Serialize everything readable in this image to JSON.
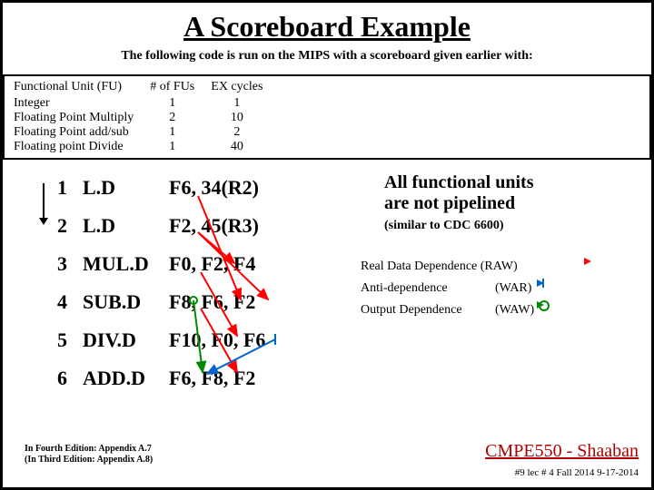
{
  "title": "A Scoreboard Example",
  "subtitle": "The following code is run on the MIPS with a scoreboard given earlier with:",
  "fu_table": {
    "headers": [
      "Functional Unit (FU)",
      "# of FUs",
      "EX cycles"
    ],
    "rows": [
      {
        "name": "Integer",
        "count": "1",
        "cycles": "1"
      },
      {
        "name": "Floating Point Multiply",
        "count": "2",
        "cycles": "10"
      },
      {
        "name": "Floating Point add/sub",
        "count": "1",
        "cycles": "2"
      },
      {
        "name": "Floating point Divide",
        "count": "1",
        "cycles": "40"
      }
    ]
  },
  "code": [
    {
      "n": "1",
      "op": "L.D",
      "args": "F6, 34(R2)"
    },
    {
      "n": "2",
      "op": "L.D",
      "args": "F2, 45(R3)"
    },
    {
      "n": "3",
      "op": "MUL.D",
      "args": "F0, F2, F4"
    },
    {
      "n": "4",
      "op": "SUB.D",
      "args": "F8, F6, F2"
    },
    {
      "n": "5",
      "op": "DIV.D",
      "args": "F10, F0, F6"
    },
    {
      "n": "6",
      "op": "ADD.D",
      "args": "F6, F8, F2"
    }
  ],
  "note_line1": "All functional units",
  "note_line2": "are not pipelined",
  "note2": "(similar to CDC 6600)",
  "legend": {
    "raw": {
      "label": "Real Data Dependence (RAW)"
    },
    "war": {
      "label": "Anti-dependence",
      "tag": "(WAR)"
    },
    "waw": {
      "label": "Output Dependence",
      "tag": "(WAW)"
    }
  },
  "footer_left_1": "In Fourth Edition: Appendix A.7",
  "footer_left_2": "(In Third Edition: Appendix A.8)",
  "footer_right": "CMPE550 - Shaaban",
  "footer_sub": "#9  lec # 4 Fall 2014   9-17-2014"
}
